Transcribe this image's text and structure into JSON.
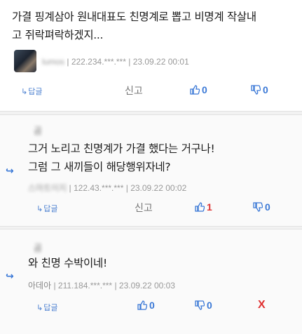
{
  "comment1": {
    "text_line1": "가결 핑계삼아 원내대표도 친명계로 뽑고 비명계 작살내",
    "text_line2": "고 쥐락펴락하겠지...",
    "nick": "lumos",
    "ip": "222.234.***.***",
    "date": "23.09.22 00:01",
    "reply_label": "답글",
    "report_label": "신고",
    "up": "0",
    "down": "0"
  },
  "reply1": {
    "nick_top": "곰",
    "text_line1": "그거 노리고 친명계가 가결 했다는 거구나!",
    "text_line2": "그럼 그 새끼들이 해당행위자네?",
    "nick": "스마트이지",
    "ip": "122.43.***.***",
    "date": "23.09.22 00:02",
    "reply_label": "답글",
    "report_label": "신고",
    "up": "1",
    "down": "0"
  },
  "reply2": {
    "nick_top": "곰",
    "text_line1": "와 친명 수박이네!",
    "nick": "아데아",
    "ip": "211.184.***.***",
    "date": "23.09.22 00:03",
    "reply_label": "답글",
    "up": "0",
    "down": "0",
    "delete_label": "X"
  },
  "icons": {
    "reply": "↳",
    "reply_arrow": "↪",
    "thumb_up": "👍",
    "thumb_down": "👎"
  },
  "colors": {
    "accent": "#3a78d6",
    "delete": "#e03030"
  }
}
